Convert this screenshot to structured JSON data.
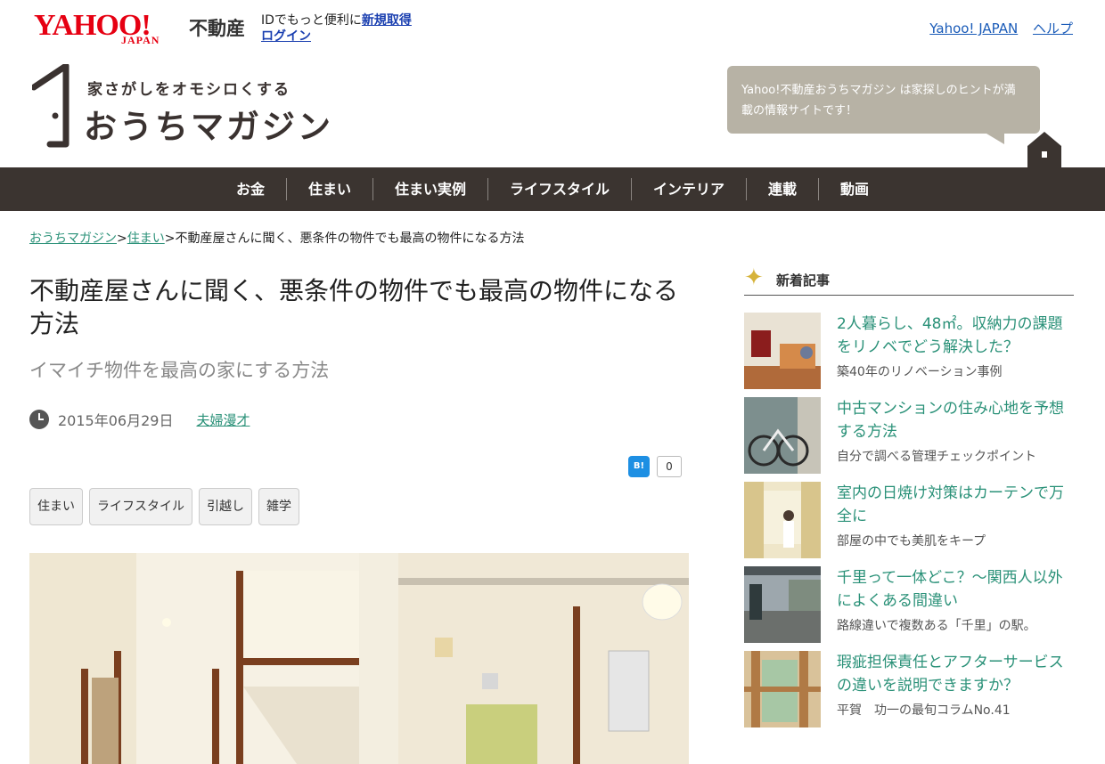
{
  "header": {
    "yahoo_word": "YAHOO!",
    "yahoo_japan": "JAPAN",
    "service": "不動産",
    "id_prefix": "IDでもっと便利に",
    "register": "新規取得",
    "login": "ログイン",
    "links": [
      "Yahoo! JAPAN",
      "ヘルプ"
    ]
  },
  "brand": {
    "tagline": "家さがしをオモシロくする",
    "name": "おうちマガジン",
    "bubble": "Yahoo!不動産おうちマガジン は家探しのヒントが満載の情報サイトです！"
  },
  "nav": [
    "お金",
    "住まい",
    "住まい実例",
    "ライフスタイル",
    "インテリア",
    "連載",
    "動画"
  ],
  "breadcrumb": {
    "home": "おうちマガジン",
    "sep1": ">",
    "category": "住まい",
    "sep2": ">",
    "current": "不動産屋さんに聞く、悪条件の物件でも最高の物件になる方法"
  },
  "article": {
    "title": "不動産屋さんに聞く、悪条件の物件でも最高の物件になる方法",
    "subtitle": "イマイチ物件を最高の家にする方法",
    "date": "2015年06月29日",
    "author": "夫婦漫才",
    "hatena_label": "B!",
    "hatena_count": "0",
    "tags": [
      "住まい",
      "ライフスタイル",
      "引越し",
      "雑学"
    ]
  },
  "sidebar": {
    "title": "新着記事",
    "items": [
      {
        "title": "2人暮らし、48㎡。収納力の課題をリノベでどう解決した？",
        "sub": "築40年のリノベーション事例"
      },
      {
        "title": "中古マンションの住み心地を予想する方法",
        "sub": "自分で調べる管理チェックポイント"
      },
      {
        "title": "室内の日焼け対策はカーテンで万全に",
        "sub": "部屋の中でも美肌をキープ"
      },
      {
        "title": "千里って一体どこ？～関西人以外によくある間違い",
        "sub": "路線違いで複数ある「千里」の駅。"
      },
      {
        "title": "瑕疵担保責任とアフターサービスの違いを説明できますか？",
        "sub": "平賀　功一の最旬コラムNo.41"
      }
    ]
  },
  "colors": {
    "nav_bg": "#3b3430",
    "accent_link": "#2a9178",
    "yahoo_red": "#e60012",
    "bubble_bg": "#b7b2a5"
  }
}
